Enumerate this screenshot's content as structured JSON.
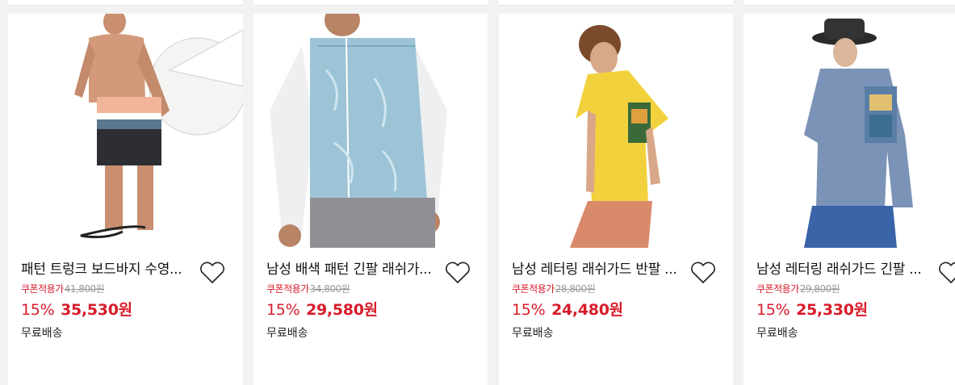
{
  "products": [
    {
      "title": "패턴 트렁크 보드바지 수영...",
      "coupon_label": "쿠폰적용가",
      "original_price": "41,800원",
      "discount": "15%",
      "price": "35,530원",
      "shipping": "무료배송",
      "image_icon": "swim-trunks-surfboard-photo"
    },
    {
      "title": "남성 배색 패턴 긴팔 래쉬가...",
      "coupon_label": "쿠폰적용가",
      "original_price": "34,800원",
      "discount": "15%",
      "price": "29,580원",
      "shipping": "무료배송",
      "image_icon": "longsleeve-rashguard-photo"
    },
    {
      "title": "남성 레터링 래쉬가드 반팔 ...",
      "coupon_label": "쿠폰적용가",
      "original_price": "28,800원",
      "discount": "15%",
      "price": "24,480원",
      "shipping": "무료배송",
      "image_icon": "yellow-tshirt-photo"
    },
    {
      "title": "남성 레터링 래쉬가드 긴팔 ...",
      "coupon_label": "쿠폰적용가",
      "original_price": "29,800원",
      "discount": "15%",
      "price": "25,330원",
      "shipping": "무료배송",
      "image_icon": "blue-longsleeve-hat-photo"
    }
  ],
  "colors": {
    "price_red": "#d81b2a",
    "strike_gray": "#999999",
    "background": "#f2f2f2"
  }
}
